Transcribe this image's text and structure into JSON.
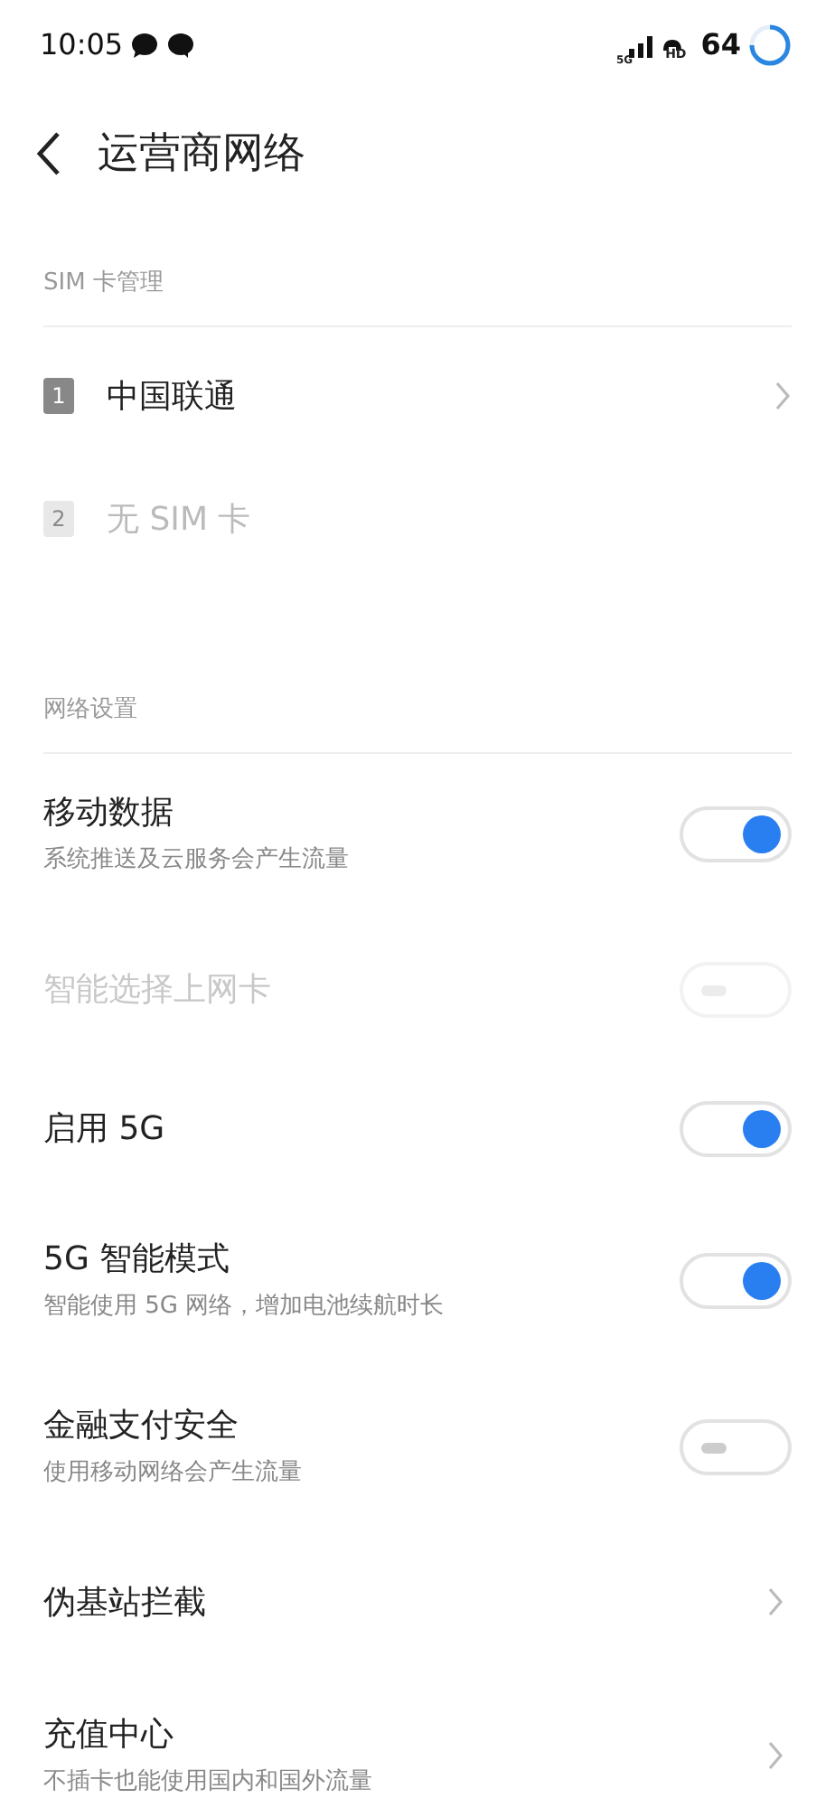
{
  "status_bar": {
    "time": "10:05",
    "network": "5G",
    "hd_label": "HD",
    "battery": "64"
  },
  "header": {
    "title": "运营商网络"
  },
  "sim_section": {
    "title": "SIM 卡管理",
    "cards": [
      {
        "slot": "1",
        "label": "中国联通",
        "disabled": false
      },
      {
        "slot": "2",
        "label": "无 SIM 卡",
        "disabled": true
      }
    ]
  },
  "network_section": {
    "title": "网络设置",
    "items": [
      {
        "kind": "toggle",
        "title": "移动数据",
        "subtitle": "系统推送及云服务会产生流量",
        "on": true,
        "disabled": false
      },
      {
        "kind": "toggle",
        "title": "智能选择上网卡",
        "on": false,
        "disabled": true
      },
      {
        "kind": "toggle",
        "title": "启用 5G",
        "on": true,
        "disabled": false
      },
      {
        "kind": "toggle",
        "title": "5G 智能模式",
        "subtitle": "智能使用 5G 网络，增加电池续航时长",
        "on": true,
        "disabled": false
      },
      {
        "kind": "toggle",
        "title": "金融支付安全",
        "subtitle": "使用移动网络会产生流量",
        "on": false,
        "disabled": false
      },
      {
        "kind": "link",
        "title": "伪基站拦截"
      },
      {
        "kind": "link",
        "title": "充值中心",
        "subtitle": "不插卡也能使用国内和国外流量"
      }
    ]
  }
}
